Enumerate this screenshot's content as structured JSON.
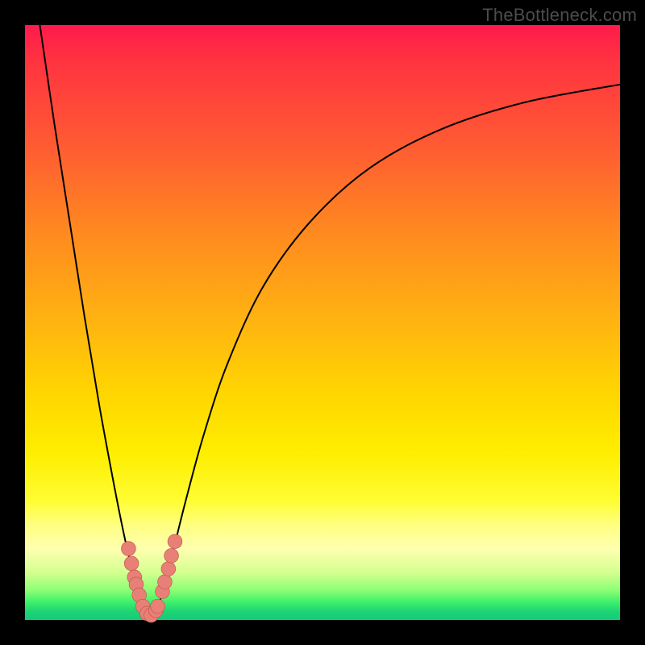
{
  "watermark": "TheBottleneck.com",
  "colors": {
    "frame": "#000000",
    "curve": "#000000",
    "marker_fill": "#e98077",
    "marker_stroke": "#c0584f"
  },
  "chart_data": {
    "type": "line",
    "title": "",
    "xlabel": "",
    "ylabel": "",
    "xlim": [
      0,
      100
    ],
    "ylim": [
      0,
      100
    ],
    "notch_x": 21,
    "series": [
      {
        "name": "left-branch",
        "x": [
          2.5,
          5,
          7.5,
          10,
          12.5,
          15,
          16.5,
          17.5,
          18.5,
          19.25,
          20,
          20.5,
          21
        ],
        "y": [
          100,
          83,
          67,
          51,
          36,
          22.5,
          15,
          10.5,
          6.5,
          4,
          2,
          1,
          0.5
        ]
      },
      {
        "name": "right-branch",
        "x": [
          21,
          21.8,
          22.6,
          23.5,
          25,
          27,
          30,
          34,
          40,
          48,
          58,
          70,
          84,
          100
        ],
        "y": [
          0.5,
          1.3,
          3,
          6,
          12,
          20,
          31,
          43,
          56,
          67,
          76,
          82.5,
          87,
          90
        ]
      }
    ],
    "markers": {
      "name": "notch-markers",
      "x": [
        17.4,
        17.9,
        18.4,
        18.7,
        19.2,
        19.8,
        20.5,
        21.2,
        22.0,
        22.3,
        23.1,
        23.5,
        24.1,
        24.6,
        25.2
      ],
      "y": [
        12.0,
        9.5,
        7.2,
        6.0,
        4.2,
        2.3,
        1.1,
        0.8,
        1.6,
        2.3,
        4.8,
        6.4,
        8.6,
        10.8,
        13.2
      ],
      "r": 1.2
    }
  }
}
